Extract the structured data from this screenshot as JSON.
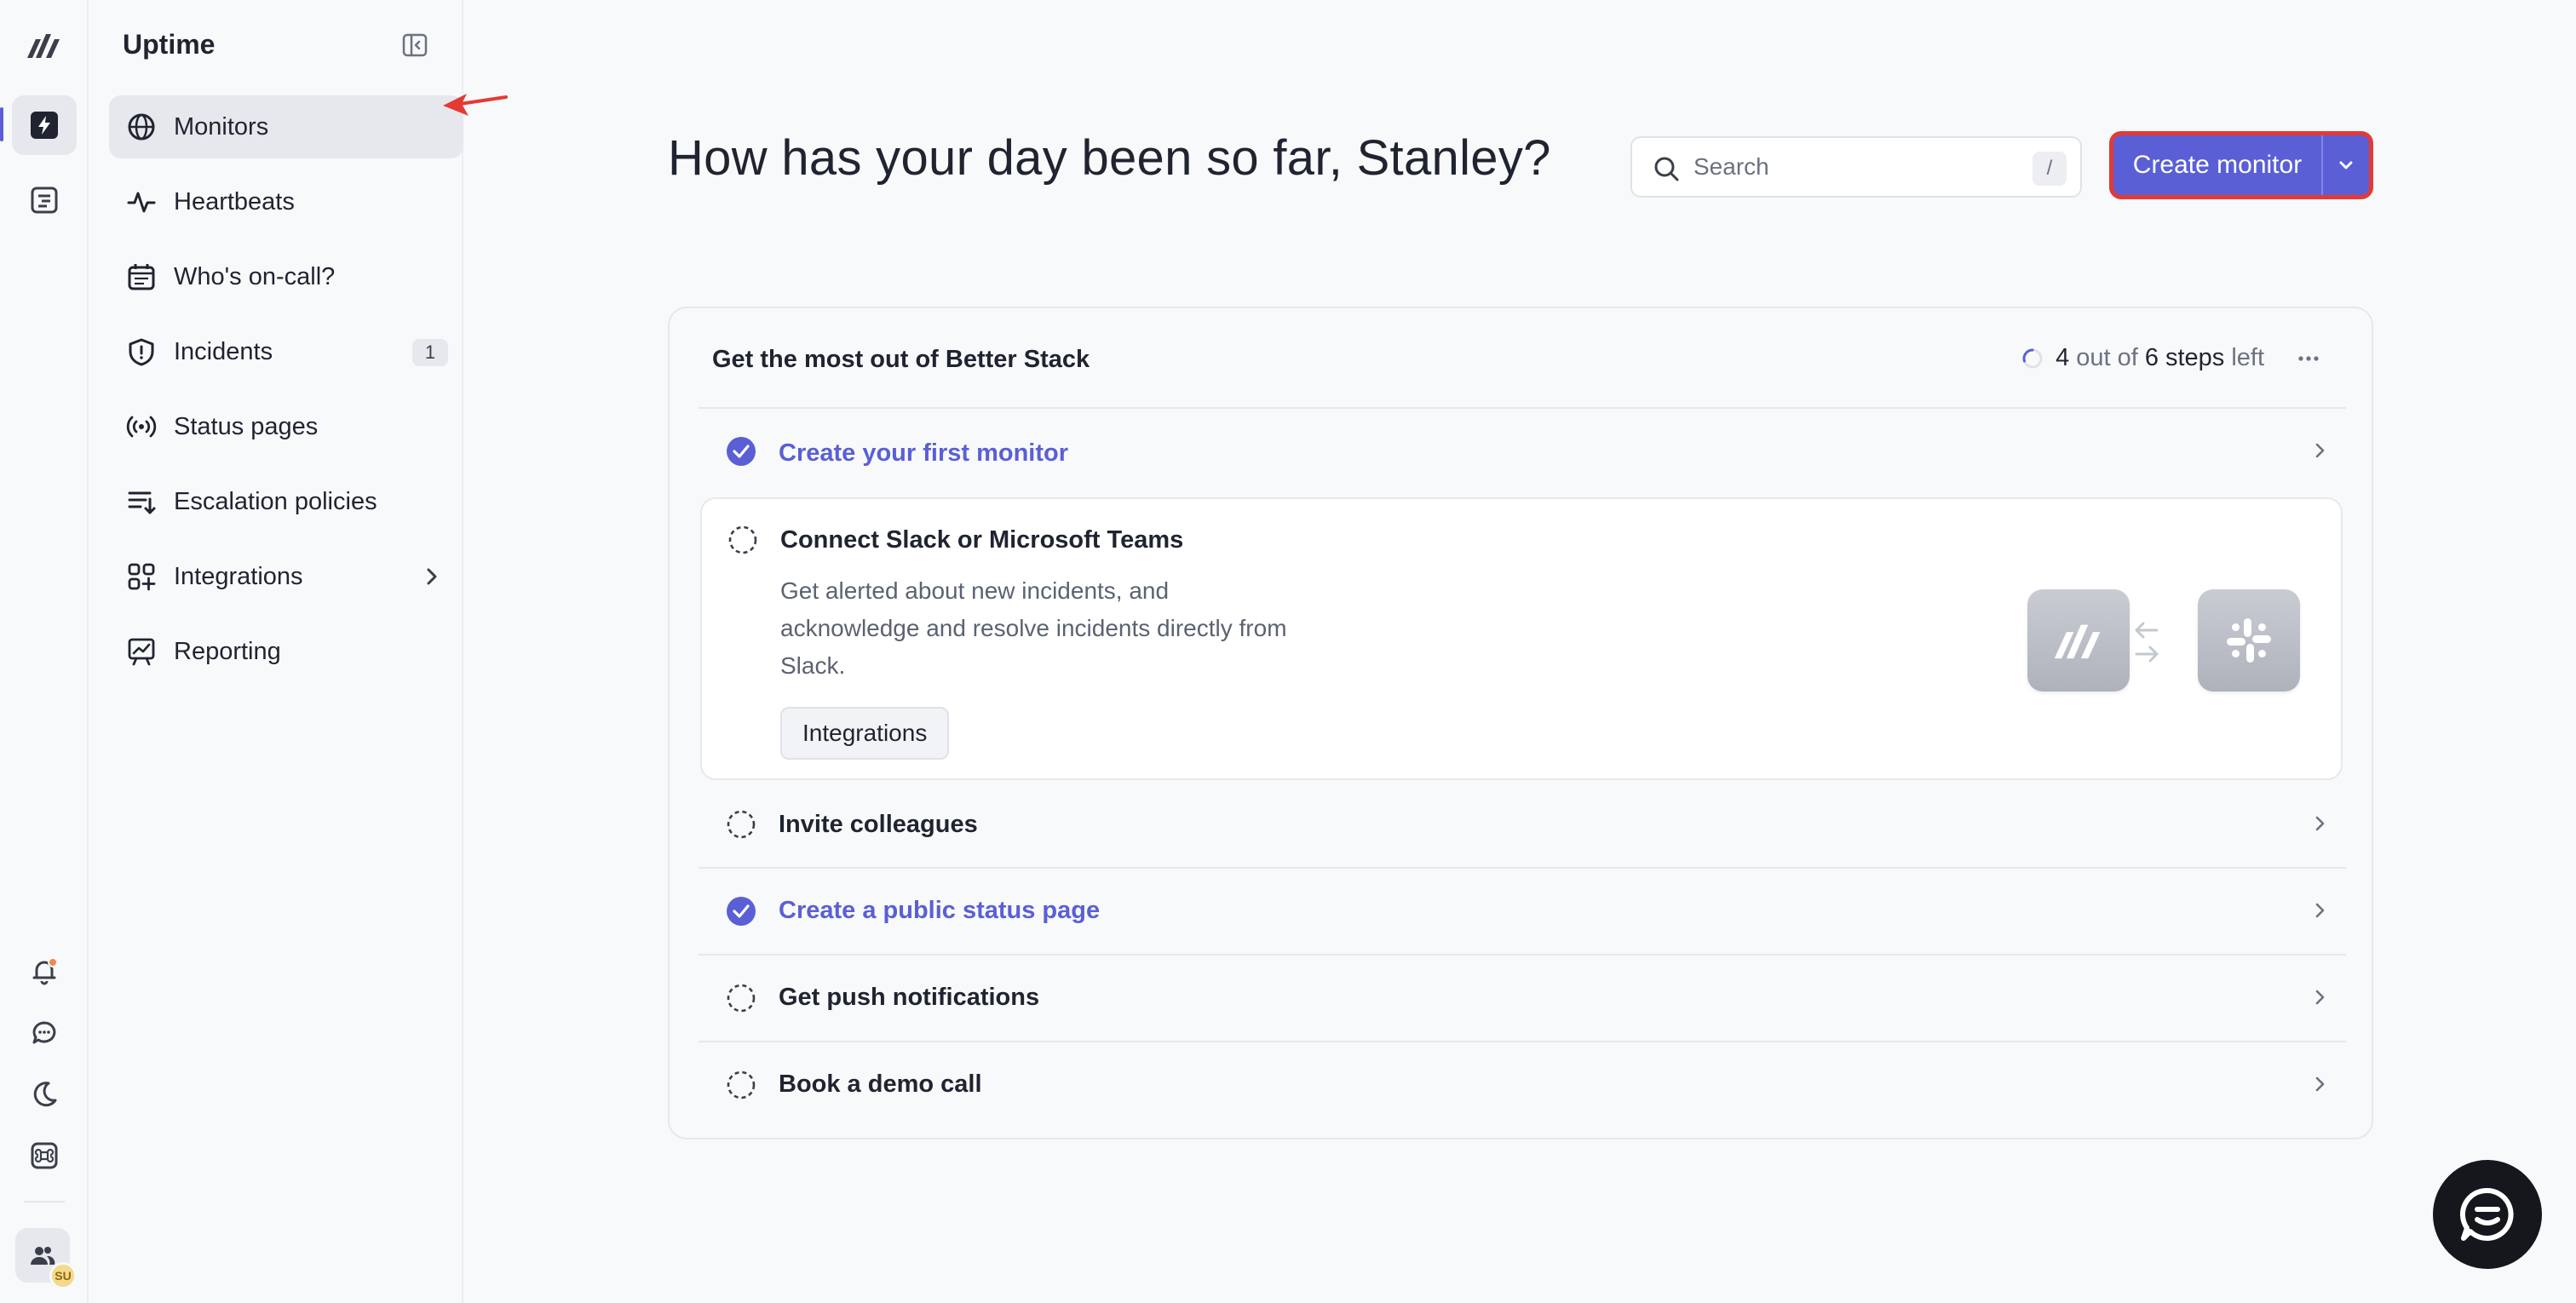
{
  "sidebar": {
    "title": "Uptime",
    "items": [
      {
        "label": "Monitors",
        "badge": ""
      },
      {
        "label": "Heartbeats",
        "badge": ""
      },
      {
        "label": "Who's on-call?",
        "badge": ""
      },
      {
        "label": "Incidents",
        "badge": "1"
      },
      {
        "label": "Status pages",
        "badge": ""
      },
      {
        "label": "Escalation policies",
        "badge": ""
      },
      {
        "label": "Integrations",
        "badge": ""
      },
      {
        "label": "Reporting",
        "badge": ""
      }
    ]
  },
  "user": {
    "initials": "SU"
  },
  "header": {
    "greeting": "How has your day been so far, Stanley?",
    "search_placeholder": "Search",
    "search_shortcut": "/",
    "create_label": "Create monitor"
  },
  "onboarding": {
    "title": "Get the most out of Better Stack",
    "progress_done": "4",
    "progress_mid": "out of",
    "progress_total": "6 steps",
    "progress_suffix": "left",
    "steps": [
      {
        "label": "Create your first monitor",
        "done": true
      },
      {
        "label": "Connect Slack or Microsoft Teams",
        "done": false,
        "description": "Get alerted about new incidents, and acknowledge and resolve incidents directly from Slack.",
        "button": "Integrations"
      },
      {
        "label": "Invite colleagues",
        "done": false
      },
      {
        "label": "Create a public status page",
        "done": true
      },
      {
        "label": "Get push notifications",
        "done": false
      },
      {
        "label": "Book a demo call",
        "done": false
      }
    ]
  },
  "colors": {
    "accent": "#5a5fd6",
    "highlight": "#e53935",
    "notification": "#f08a4b"
  }
}
